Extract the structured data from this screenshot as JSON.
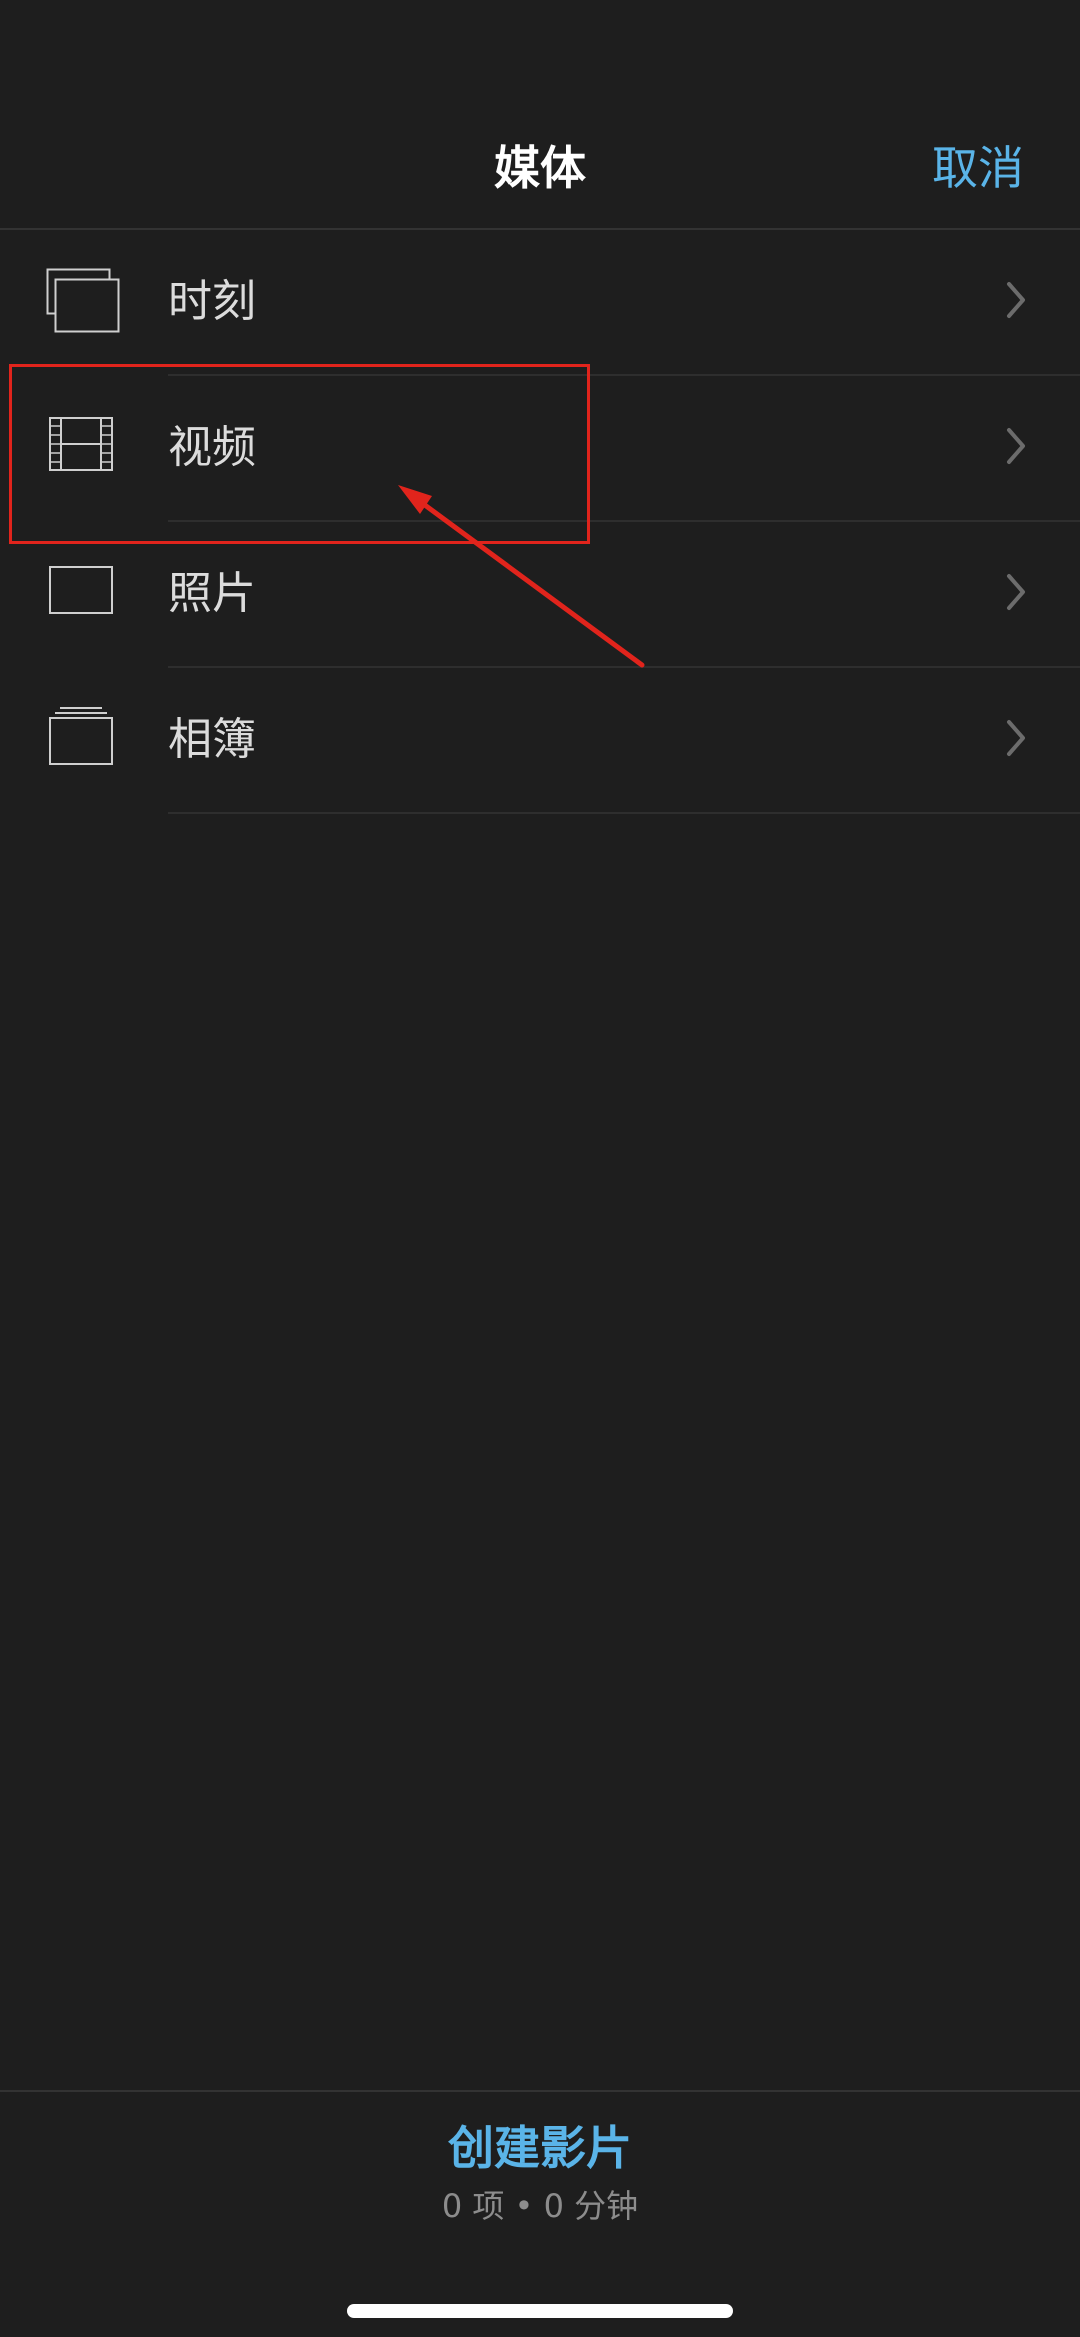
{
  "nav": {
    "title": "媒体",
    "cancel_label": "取消"
  },
  "media_list": [
    {
      "label": "时刻",
      "icon": "moments-icon"
    },
    {
      "label": "视频",
      "icon": "film-icon"
    },
    {
      "label": "照片",
      "icon": "photo-icon"
    },
    {
      "label": "相簿",
      "icon": "album-icon"
    }
  ],
  "footer": {
    "create_label": "创建影片",
    "summary": "0 项 • 0 分钟"
  },
  "colors": {
    "background": "#1e1e1e",
    "accent": "#5ab4e8",
    "annotation": "#e1241c"
  }
}
